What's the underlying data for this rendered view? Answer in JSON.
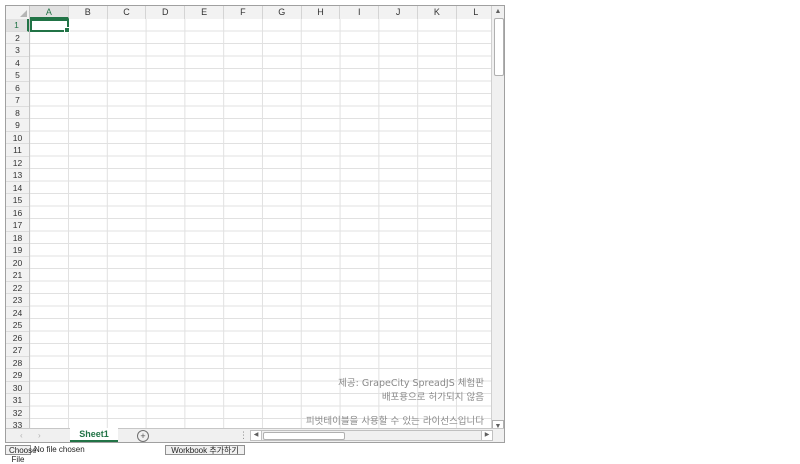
{
  "sheet": {
    "columns": [
      "A",
      "B",
      "C",
      "D",
      "E",
      "F",
      "G",
      "H",
      "I",
      "J",
      "K",
      "L"
    ],
    "rows": [
      "1",
      "2",
      "3",
      "4",
      "5",
      "6",
      "7",
      "8",
      "9",
      "10",
      "11",
      "12",
      "13",
      "14",
      "15",
      "16",
      "17",
      "18",
      "19",
      "20",
      "21",
      "22",
      "23",
      "24",
      "25",
      "26",
      "27",
      "28",
      "29",
      "30",
      "31",
      "32",
      "33"
    ],
    "active_column": "A",
    "active_row": "1"
  },
  "watermark": {
    "line1": "제공: GrapeCity SpreadJS 체험판",
    "line2": "배포용으로 허가되지 않음",
    "line3": "피벗테이블을 사용할 수 있는 라이선스입니다"
  },
  "tabs": [
    {
      "label": "Sheet1",
      "active": true
    }
  ],
  "icons": {
    "add_sheet": "plus-circle-icon",
    "nav_first": "chevron-left-icon",
    "nav_next": "chevron-right-icon",
    "splitter": "splitter-dots-icon",
    "scroll_up": "triangle-up-icon",
    "scroll_down": "triangle-down-icon",
    "scroll_left": "triangle-left-icon",
    "scroll_right": "triangle-right-icon"
  },
  "footer": {
    "file_button": "Choose File",
    "file_status": "No file chosen",
    "save_button": "Workbook 추가하기"
  },
  "colors": {
    "accent": "#217346",
    "gridline": "#e1e1e1",
    "header_bg": "#f2f2f2",
    "watermark": "#8a8a8a"
  }
}
